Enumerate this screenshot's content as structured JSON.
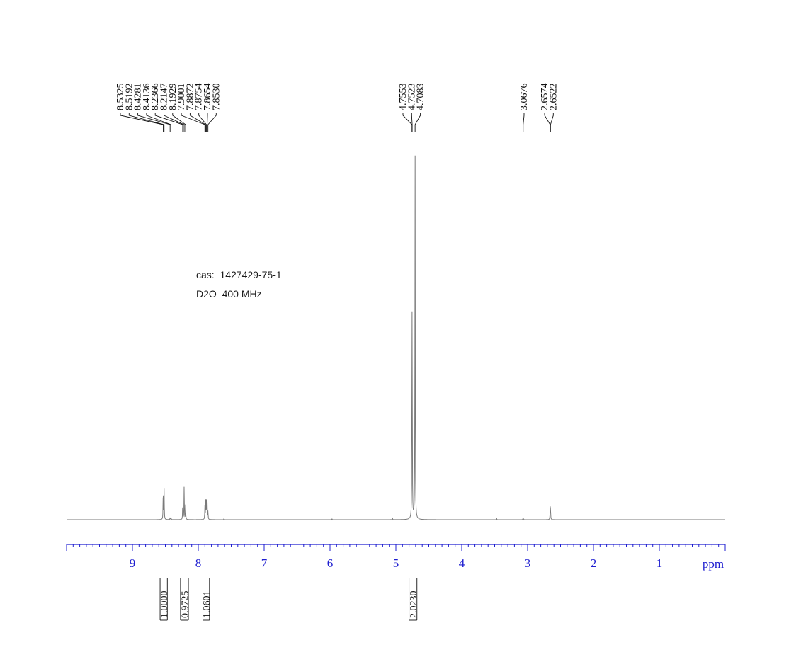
{
  "chart_data": {
    "type": "line",
    "title": "",
    "xlabel": "ppm",
    "ylabel": "",
    "xlim": [
      10.0,
      0.0
    ],
    "x_ticks": [
      "9",
      "8",
      "7",
      "6",
      "5",
      "4",
      "3",
      "2",
      "1"
    ],
    "x_unit_label": "ppm",
    "annotations": [
      "cas:  1427429-75-1",
      "D2O  400 MHz"
    ],
    "peak_labels": [
      {
        "group": "aromatic",
        "values": [
          "8.5325",
          "8.5192",
          "8.4281",
          "8.4136",
          "8.2366",
          "8.2147",
          "8.1929",
          "7.9001",
          "7.8872",
          "7.8754",
          "7.8654",
          "7.8530"
        ]
      },
      {
        "group": "solvent",
        "values": [
          "4.7553",
          "4.7523",
          "4.7083"
        ]
      },
      {
        "group": "singlet",
        "values": [
          "3.0676"
        ]
      },
      {
        "group": "aliphatic",
        "values": [
          "2.6574",
          "2.6522"
        ]
      }
    ],
    "integrals": [
      {
        "from": 8.58,
        "to": 8.47,
        "value": "1.0000"
      },
      {
        "from": 8.27,
        "to": 8.15,
        "value": "0.9725"
      },
      {
        "from": 7.93,
        "to": 7.83,
        "value": "1.0601"
      },
      {
        "from": 4.8,
        "to": 4.68,
        "value": "2.0230"
      }
    ],
    "peaks": [
      {
        "ppm": 8.5325,
        "height": 0.082
      },
      {
        "ppm": 8.5192,
        "height": 0.08
      },
      {
        "ppm": 8.4281,
        "height": 0.006
      },
      {
        "ppm": 8.4136,
        "height": 0.005
      },
      {
        "ppm": 8.2366,
        "height": 0.042
      },
      {
        "ppm": 8.2147,
        "height": 0.09
      },
      {
        "ppm": 8.1929,
        "height": 0.04
      },
      {
        "ppm": 7.9001,
        "height": 0.034
      },
      {
        "ppm": 7.8872,
        "height": 0.058
      },
      {
        "ppm": 7.8754,
        "height": 0.06
      },
      {
        "ppm": 7.8654,
        "height": 0.04
      },
      {
        "ppm": 7.853,
        "height": 0.022
      },
      {
        "ppm": 7.61,
        "height": 0.003
      },
      {
        "ppm": 5.97,
        "height": 0.002
      },
      {
        "ppm": 5.05,
        "height": 0.003
      },
      {
        "ppm": 4.7553,
        "height": 0.36
      },
      {
        "ppm": 4.7523,
        "height": 0.34
      },
      {
        "ppm": 4.7083,
        "height": 1.0
      },
      {
        "ppm": 3.47,
        "height": 0.003
      },
      {
        "ppm": 3.0676,
        "height": 0.007
      },
      {
        "ppm": 2.6574,
        "height": 0.03
      },
      {
        "ppm": 2.6522,
        "height": 0.026
      }
    ],
    "colors": {
      "axis": "#1f1fd0",
      "spectrum": "#7a7a7a",
      "labels": "#111111"
    }
  }
}
